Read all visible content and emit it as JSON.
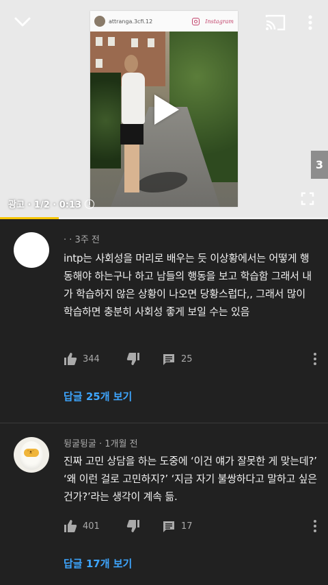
{
  "player": {
    "post_username": "attranga.3cfi.12",
    "post_brand": "Instagram",
    "ad_label": "광고 · 1/2 · 0:13",
    "side_tab": "3",
    "progress_fraction": 0.18,
    "progress_color": "#f7c600",
    "icons": [
      "chevron-down-icon",
      "cast-icon",
      "more-vert-icon",
      "play-icon",
      "info-icon",
      "fullscreen-icon"
    ]
  },
  "comments": [
    {
      "author": "·",
      "time": "· 3주 전",
      "text": "intp는 사회성을 머리로 배우는 듯 이상황에서는 어떻게 행동해야 하는구나 하고 남들의 행동을 보고 학습함 그래서 내가 학습하지 않은 상황이 나오면 당황스럽다,, 그래서 많이 학습하면 충분히 사회성 좋게 보일 수는 있음",
      "likes": "344",
      "replies_count": "25",
      "view_replies": "답글 25개 보기"
    },
    {
      "author": "뒹굴뒹굴",
      "time": "· 1개월 전",
      "text": "진짜 고민 상담을 하는 도중에 ‘이건 얘가 잘못한 게 맞는데?’ ‘왜 이런 걸로 고민하지?’ ‘지금 자기 불쌍하다고 말하고 싶은 건가?’라는 생각이 계속 듦.",
      "likes": "401",
      "replies_count": "17",
      "view_replies": "답글 17개 보기"
    }
  ],
  "colors": {
    "background": "#212121",
    "link": "#3ea6ff",
    "secondary_text": "#aaaaaa"
  }
}
